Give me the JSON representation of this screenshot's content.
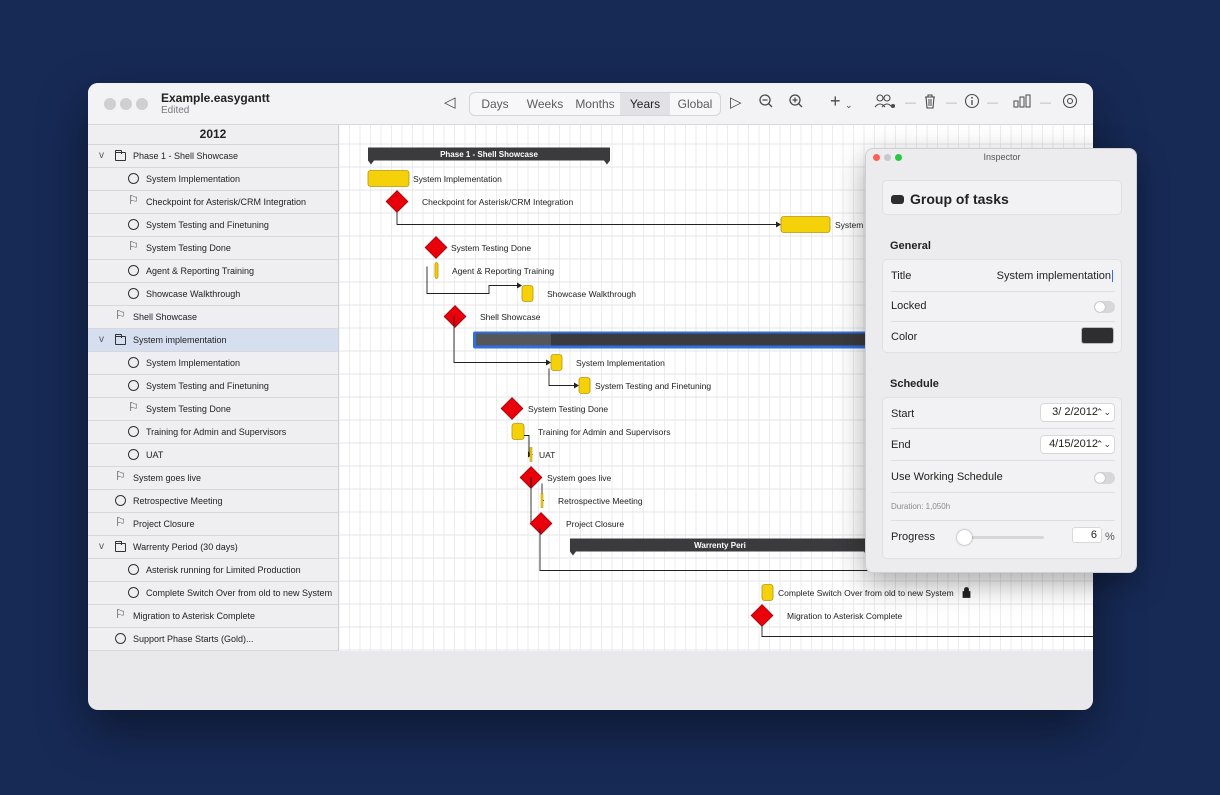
{
  "window": {
    "title": "Example.easygantt",
    "subtitle": "Edited"
  },
  "toolbar": {
    "views": [
      "Days",
      "Weeks",
      "Months",
      "Years",
      "Global"
    ],
    "active_view": "Years",
    "icons": [
      "back-triangle-icon",
      "forward-triangle-icon",
      "zoom-out-icon",
      "zoom-in-icon",
      "add-icon",
      "resources-icon",
      "trash-icon",
      "info-icon",
      "chart-icon",
      "settings-icon"
    ]
  },
  "list": {
    "year": "2012",
    "rows": [
      {
        "label": "Phase 1 - Shell Showcase",
        "icon": "folder",
        "indent": 0,
        "chevron": true,
        "selected": false
      },
      {
        "label": "System Implementation",
        "icon": "circle",
        "indent": 1,
        "selected": false
      },
      {
        "label": "Checkpoint for Asterisk/CRM Integration",
        "icon": "flag",
        "indent": 1,
        "selected": false
      },
      {
        "label": "System Testing and Finetuning",
        "icon": "circle",
        "indent": 1,
        "selected": false
      },
      {
        "label": "System Testing Done",
        "icon": "flag",
        "indent": 1,
        "selected": false
      },
      {
        "label": "Agent & Reporting Training",
        "icon": "circle",
        "indent": 1,
        "selected": false
      },
      {
        "label": "Showcase Walkthrough",
        "icon": "circle",
        "indent": 1,
        "selected": false
      },
      {
        "label": "Shell Showcase",
        "icon": "flag",
        "indent": 0,
        "selected": false
      },
      {
        "label": "System implementation",
        "icon": "folder",
        "indent": 0,
        "chevron": true,
        "selected": true
      },
      {
        "label": "System Implementation",
        "icon": "circle",
        "indent": 1,
        "selected": false
      },
      {
        "label": "System Testing and Finetuning",
        "icon": "circle",
        "indent": 1,
        "selected": false
      },
      {
        "label": "System Testing Done",
        "icon": "flag",
        "indent": 1,
        "selected": false
      },
      {
        "label": "Training for Admin and Supervisors",
        "icon": "circle",
        "indent": 1,
        "selected": false
      },
      {
        "label": "UAT",
        "icon": "circle",
        "indent": 1,
        "selected": false
      },
      {
        "label": "System goes live",
        "icon": "flag",
        "indent": 0,
        "selected": false
      },
      {
        "label": "Retrospective Meeting",
        "icon": "circle",
        "indent": 0,
        "selected": false
      },
      {
        "label": "Project Closure",
        "icon": "flag",
        "indent": 0,
        "selected": false
      },
      {
        "label": "Warrenty Period (30 days)",
        "icon": "folder",
        "indent": 0,
        "chevron": true,
        "selected": false
      },
      {
        "label": "Asterisk running for Limited Production",
        "icon": "circle",
        "indent": 1,
        "selected": false
      },
      {
        "label": "Complete Switch Over from old to new System",
        "icon": "circle",
        "indent": 1,
        "selected": false
      },
      {
        "label": "Migration to Asterisk Complete",
        "icon": "flag",
        "indent": 0,
        "selected": false
      },
      {
        "label": "Support Phase Starts (Gold)...",
        "icon": "circle",
        "indent": 0,
        "selected": false
      }
    ]
  },
  "gantt": {
    "summary_labels": [
      "Phase 1 - Shell Showcase",
      "Warrenty Peri"
    ],
    "bar_labels": [
      "System Implementation",
      "Checkpoint for Asterisk/CRM Integration",
      "System",
      "System Testing Done",
      "Agent & Reporting Training",
      "Showcase Walkthrough",
      "Shell Showcase",
      "System Implementation",
      "System Testing and Finetuning",
      "System Testing Done",
      "Training for Admin and Supervisors",
      "UAT",
      "System goes live",
      "Retrospective Meeting",
      "Project Closure",
      "Complete Switch Over from old to new System",
      "Migration to Asterisk Complete"
    ],
    "colors": {
      "task": "#f5d10a",
      "milestone": "#e8000b",
      "summary": "#3b3b3d",
      "selected_summary": "#2f6fe0"
    }
  },
  "inspector": {
    "window_title": "Inspector",
    "header": "Group of tasks",
    "general_label": "General",
    "title_label": "Title",
    "title_value": "System implementation",
    "locked_label": "Locked",
    "locked": false,
    "color_label": "Color",
    "color_value": "#2e2e30",
    "schedule_label": "Schedule",
    "start_label": "Start",
    "start_value": "3/  2/2012",
    "end_label": "End",
    "end_value": "4/15/2012",
    "working_schedule_label": "Use Working Schedule",
    "working_schedule": false,
    "duration_text": "Duration: 1,050h",
    "progress_label": "Progress",
    "progress_value": "6",
    "progress_unit": "%",
    "progress_fraction": 0.06
  }
}
